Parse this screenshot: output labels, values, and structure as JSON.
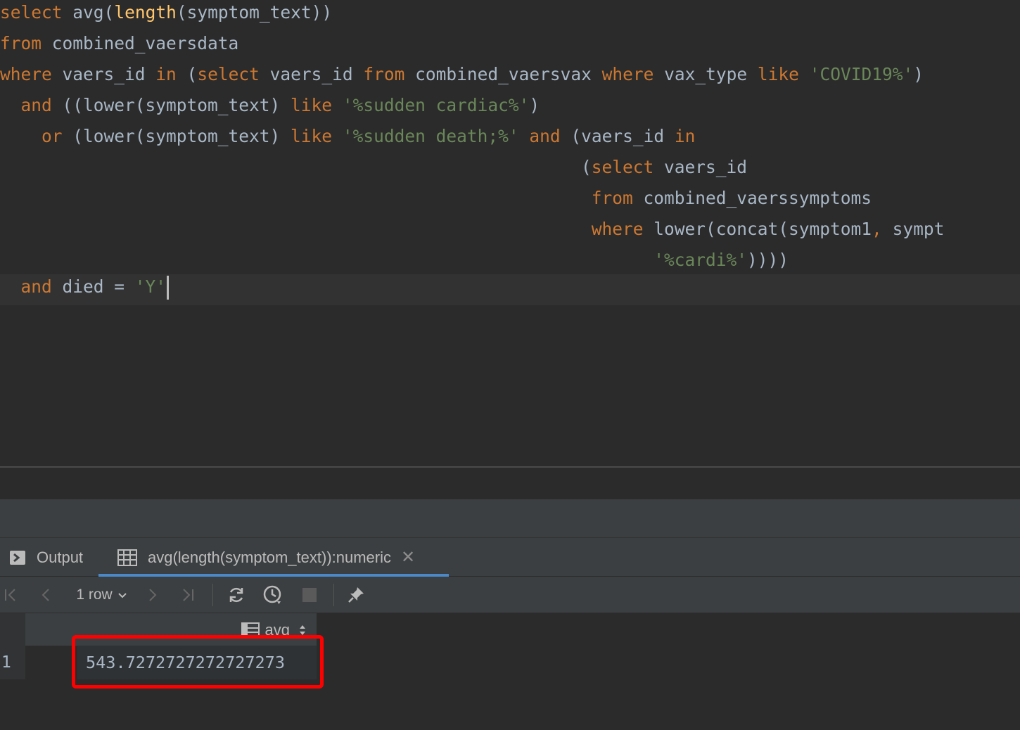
{
  "editor": {
    "lines": [
      [
        {
          "t": "select",
          "c": "kw"
        },
        {
          "t": " ",
          "c": "op"
        },
        {
          "t": "avg",
          "c": "id"
        },
        {
          "t": "(",
          "c": "op"
        },
        {
          "t": "length",
          "c": "fn"
        },
        {
          "t": "(symptom_text))",
          "c": "id"
        }
      ],
      [
        {
          "t": "from",
          "c": "kw"
        },
        {
          "t": " combined_vaersdata",
          "c": "id"
        }
      ],
      [
        {
          "t": "where",
          "c": "kw"
        },
        {
          "t": " vaers_id ",
          "c": "id"
        },
        {
          "t": "in",
          "c": "kw"
        },
        {
          "t": " (",
          "c": "op"
        },
        {
          "t": "select",
          "c": "kw"
        },
        {
          "t": " vaers_id ",
          "c": "id"
        },
        {
          "t": "from",
          "c": "kw"
        },
        {
          "t": " combined_vaersvax ",
          "c": "id"
        },
        {
          "t": "where",
          "c": "kw"
        },
        {
          "t": " vax_type ",
          "c": "id"
        },
        {
          "t": "like",
          "c": "kw"
        },
        {
          "t": " ",
          "c": "op"
        },
        {
          "t": "'COVID19%'",
          "c": "str"
        },
        {
          "t": ")",
          "c": "op"
        }
      ],
      [
        {
          "t": "  ",
          "c": "op"
        },
        {
          "t": "and",
          "c": "kw"
        },
        {
          "t": " ((lower(symptom_text) ",
          "c": "id"
        },
        {
          "t": "like",
          "c": "kw"
        },
        {
          "t": " ",
          "c": "op"
        },
        {
          "t": "'%sudden cardiac%'",
          "c": "str"
        },
        {
          "t": ")",
          "c": "op"
        }
      ],
      [
        {
          "t": "    ",
          "c": "op"
        },
        {
          "t": "or",
          "c": "kw"
        },
        {
          "t": " (lower(symptom_text) ",
          "c": "id"
        },
        {
          "t": "like",
          "c": "kw"
        },
        {
          "t": " ",
          "c": "op"
        },
        {
          "t": "'%sudden death;%'",
          "c": "str"
        },
        {
          "t": " ",
          "c": "op"
        },
        {
          "t": "and",
          "c": "kw"
        },
        {
          "t": " (vaers_id ",
          "c": "id"
        },
        {
          "t": "in",
          "c": "kw"
        }
      ],
      [
        {
          "t": "                                                        (",
          "c": "op"
        },
        {
          "t": "select",
          "c": "kw"
        },
        {
          "t": " vaers_id",
          "c": "id"
        }
      ],
      [
        {
          "t": "                                                         ",
          "c": "op"
        },
        {
          "t": "from",
          "c": "kw"
        },
        {
          "t": " combined_vaerssymptoms",
          "c": "id"
        }
      ],
      [
        {
          "t": "                                                         ",
          "c": "op"
        },
        {
          "t": "where",
          "c": "kw"
        },
        {
          "t": " lower(concat(symptom1",
          "c": "id"
        },
        {
          "t": ",",
          "c": "kw"
        },
        {
          "t": " sympt",
          "c": "id"
        }
      ],
      [
        {
          "t": "                                                               ",
          "c": "op"
        },
        {
          "t": "'%cardi%'",
          "c": "str"
        },
        {
          "t": "))))",
          "c": "op"
        }
      ],
      [
        {
          "t": "  ",
          "c": "op"
        },
        {
          "t": "and",
          "c": "kw"
        },
        {
          "t": " died = ",
          "c": "id"
        },
        {
          "t": "'Y'",
          "c": "str"
        }
      ]
    ],
    "current_line": 9
  },
  "tabs": {
    "output_label": "Output",
    "result_label": "avg(length(symptom_text)):numeric"
  },
  "toolbar": {
    "row_count": "1 row"
  },
  "grid": {
    "column_header": "avg",
    "row_number": "1",
    "value": "543.7272727272727273"
  },
  "colors": {
    "keyword": "#cc7832",
    "function": "#ffc66d",
    "string": "#6a8759",
    "identifier": "#a9b7c6",
    "highlight_box": "#ff0000",
    "active_tab": "#4a88c7"
  }
}
